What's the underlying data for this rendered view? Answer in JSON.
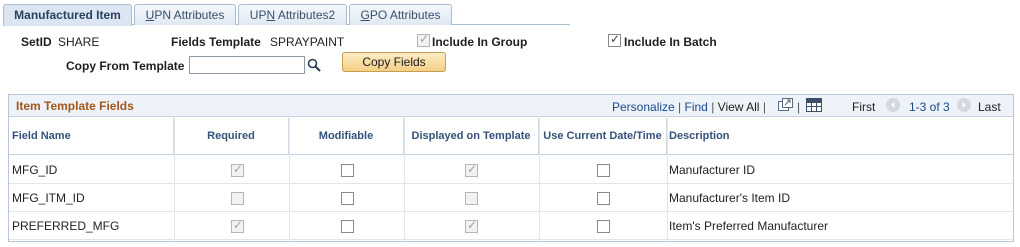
{
  "tabs": [
    {
      "pre": "",
      "acc": "",
      "post": "Manufactured Item"
    },
    {
      "pre": "",
      "acc": "U",
      "post": "PN Attributes"
    },
    {
      "pre": "UP",
      "acc": "N",
      "post": " Attributes2"
    },
    {
      "pre": "",
      "acc": "G",
      "post": "PO Attributes"
    }
  ],
  "header": {
    "setid_label": "SetID",
    "setid_value": "SHARE",
    "fields_template_label": "Fields Template",
    "fields_template_value": "SPRAYPAINT",
    "include_group_label": "Include In Group",
    "include_batch_label": "Include In Batch",
    "copy_from_label": "Copy From Template",
    "copy_from_value": "",
    "copy_fields_button": "Copy Fields"
  },
  "grid": {
    "title": "Item Template Fields",
    "personalize": "Personalize",
    "find": "Find",
    "view_all": "View All",
    "first": "First",
    "range": "1-3 of 3",
    "last": "Last",
    "columns": [
      "Field Name",
      "Required",
      "Modifiable",
      "Displayed on Template",
      "Use Current Date/Time",
      "Description"
    ],
    "rows": [
      {
        "field": "MFG_ID",
        "required": true,
        "modifiable": false,
        "displayed": true,
        "use_date": false,
        "desc": "Manufacturer ID"
      },
      {
        "field": "MFG_ITM_ID",
        "required": false,
        "modifiable": false,
        "displayed": false,
        "use_date": false,
        "desc": "Manufacturer's Item ID"
      },
      {
        "field": "PREFERRED_MFG",
        "required": true,
        "modifiable": false,
        "displayed": true,
        "use_date": false,
        "desc": "Item's Preferred Manufacturer"
      }
    ]
  }
}
